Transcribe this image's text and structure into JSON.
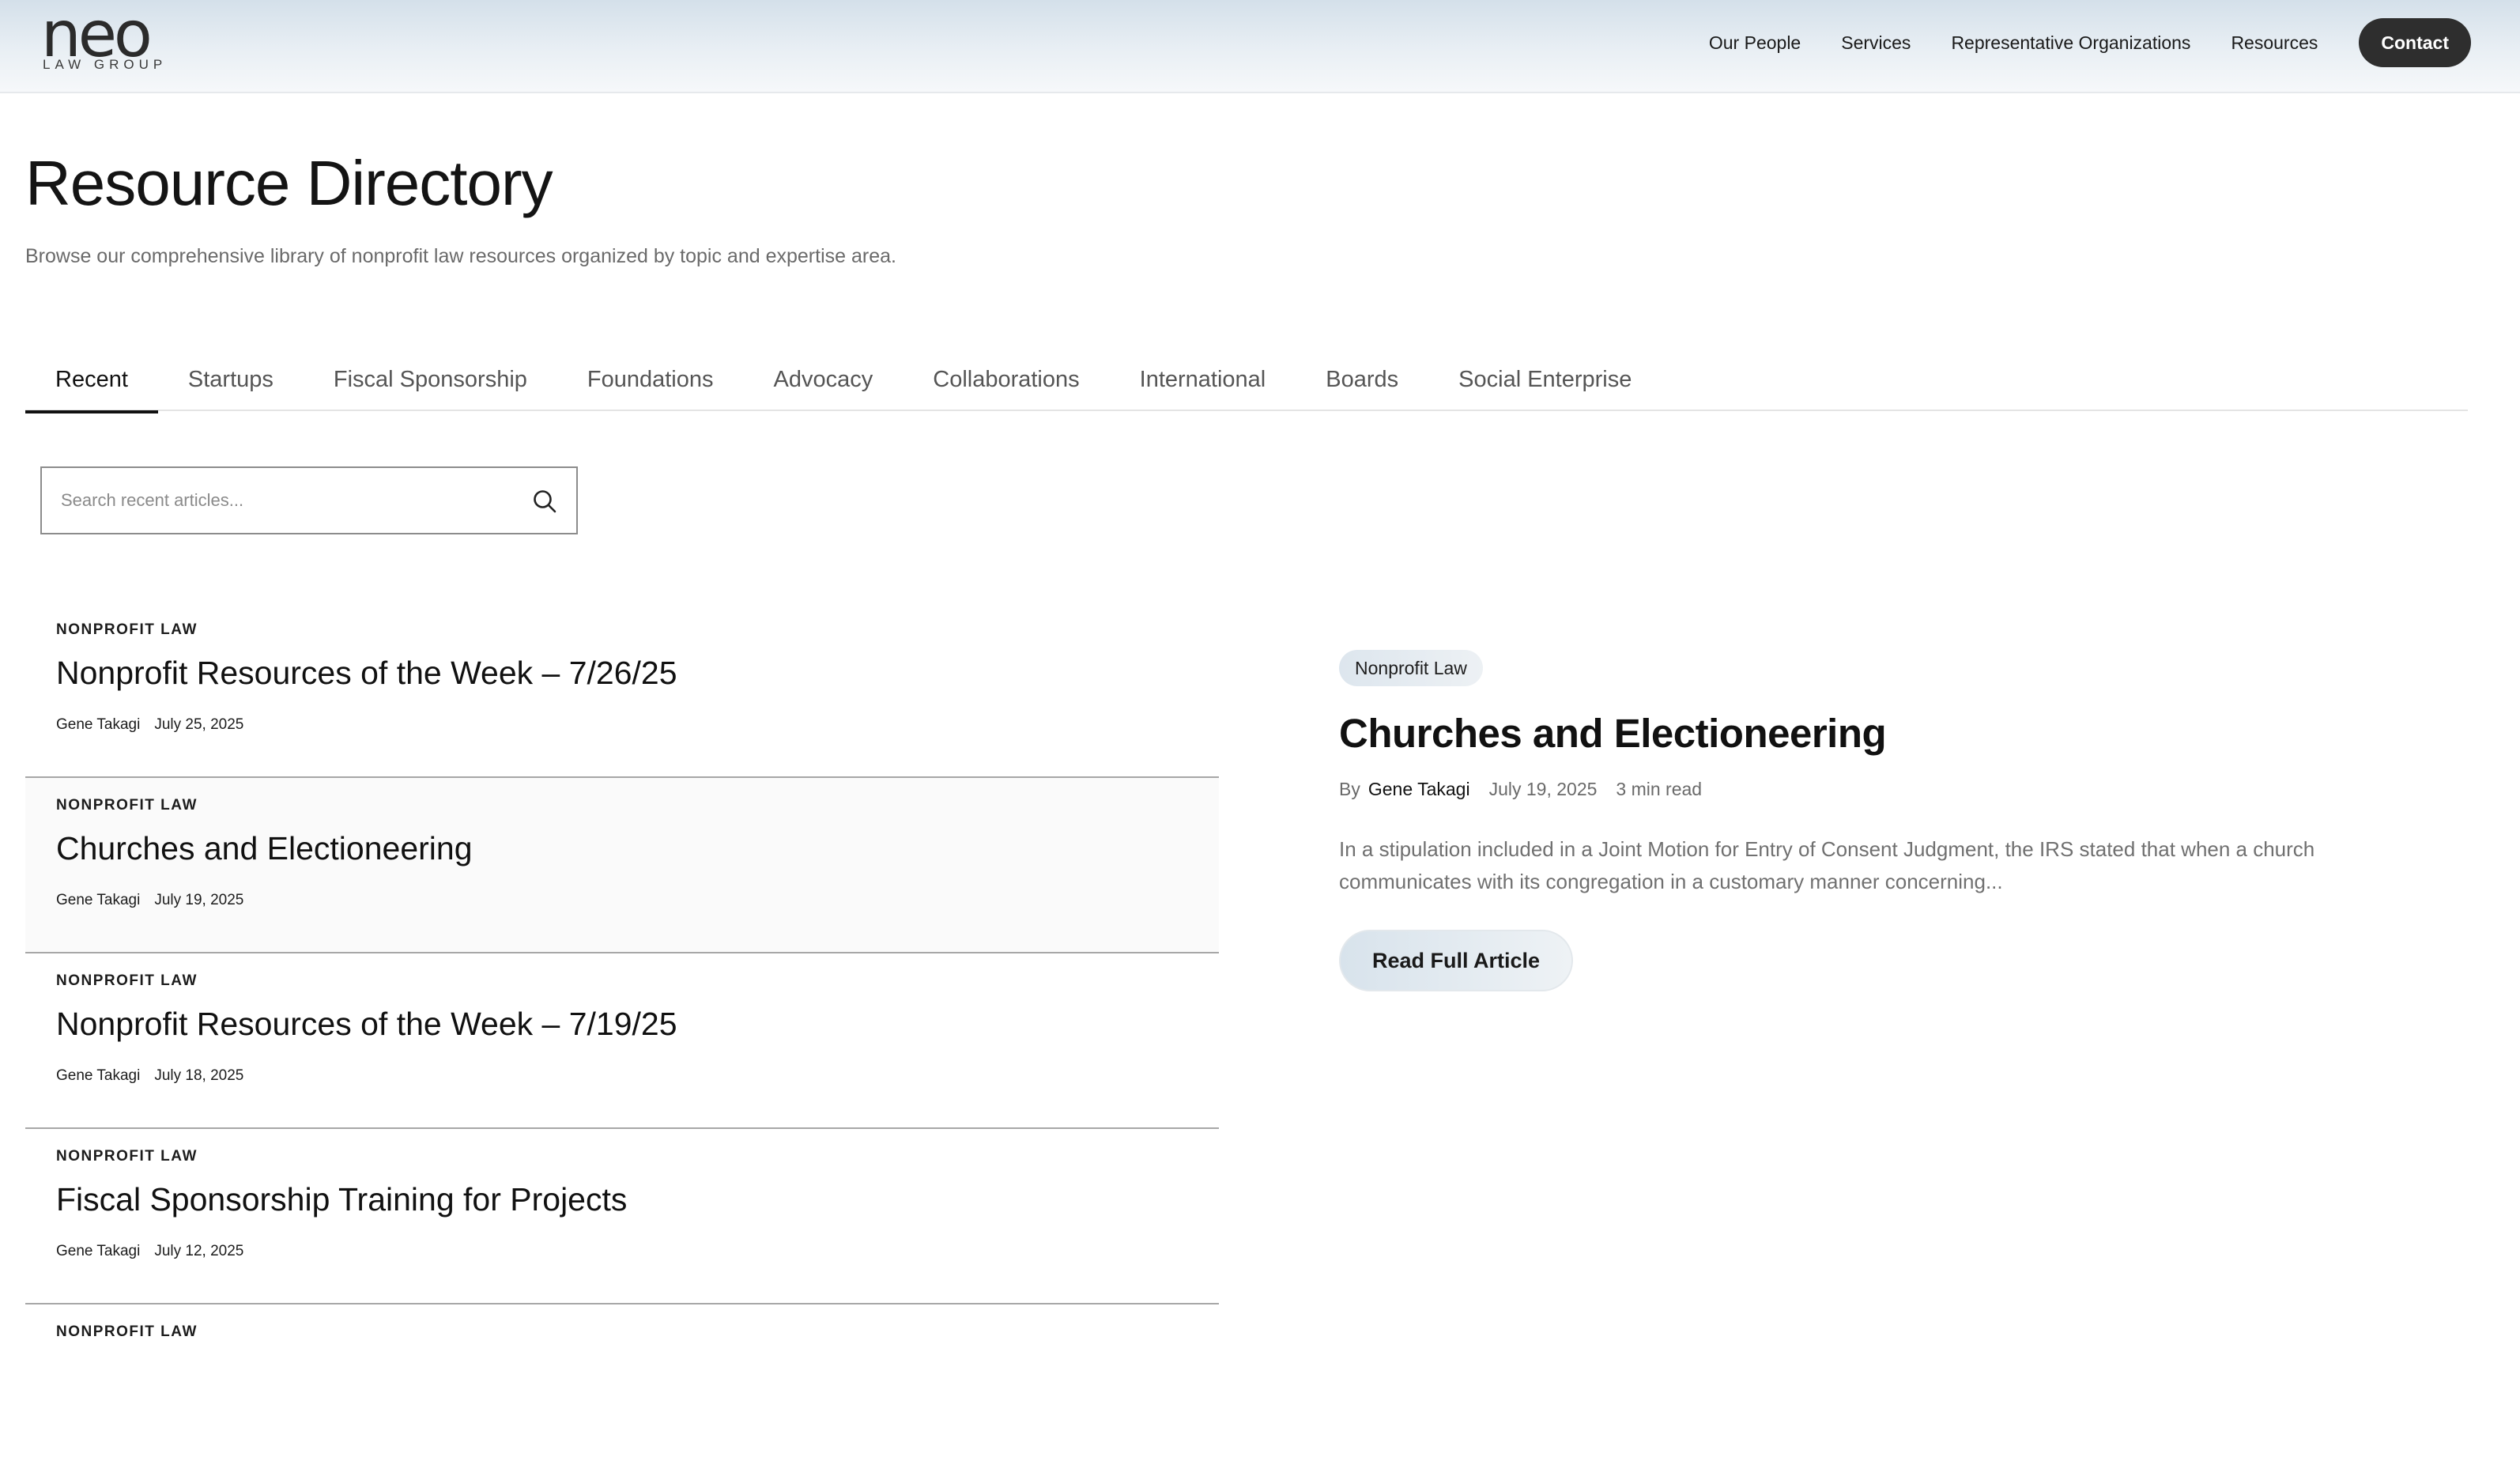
{
  "header": {
    "logo_text": "neo",
    "logo_subtext": "LAW GROUP",
    "nav": [
      "Our People",
      "Services",
      "Representative Organizations",
      "Resources"
    ],
    "contact_label": "Contact"
  },
  "page": {
    "title": "Resource Directory",
    "subtitle": "Browse our comprehensive library of nonprofit law resources organized by topic and expertise area."
  },
  "tabs": [
    "Recent",
    "Startups",
    "Fiscal Sponsorship",
    "Foundations",
    "Advocacy",
    "Collaborations",
    "International",
    "Boards",
    "Social Enterprise"
  ],
  "active_tab": "Recent",
  "search": {
    "placeholder": "Search recent articles...",
    "icon": "search-icon"
  },
  "articles": [
    {
      "category": "NONPROFIT LAW",
      "title": "Nonprofit Resources of the Week – 7/26/25",
      "author": "Gene Takagi",
      "date": "July 25, 2025"
    },
    {
      "category": "NONPROFIT LAW",
      "title": "Churches and Electioneering",
      "author": "Gene Takagi",
      "date": "July 19, 2025"
    },
    {
      "category": "NONPROFIT LAW",
      "title": "Nonprofit Resources of the Week – 7/19/25",
      "author": "Gene Takagi",
      "date": "July 18, 2025"
    },
    {
      "category": "NONPROFIT LAW",
      "title": "Fiscal Sponsorship Training for Projects",
      "author": "Gene Takagi",
      "date": "July 12, 2025"
    },
    {
      "category": "NONPROFIT LAW",
      "title": "",
      "author": "",
      "date": ""
    }
  ],
  "featured": {
    "badge": "Nonprofit Law",
    "title": "Churches and Electioneering",
    "by_label": "By",
    "author": "Gene Takagi",
    "date": "July 19, 2025",
    "read_time": "3 min read",
    "excerpt": "In a stipulation included in a Joint Motion for Entry of Consent Judgment, the IRS stated that when a church communicates with its congregation in a customary manner concerning...",
    "button_label": "Read Full Article"
  },
  "colors": {
    "header_gradient_top": "#d4e0ea",
    "text_primary": "#111111",
    "text_muted": "#6a6a6a",
    "contact_bg": "#2e2e2e",
    "badge_bg": "#dde6ee"
  }
}
